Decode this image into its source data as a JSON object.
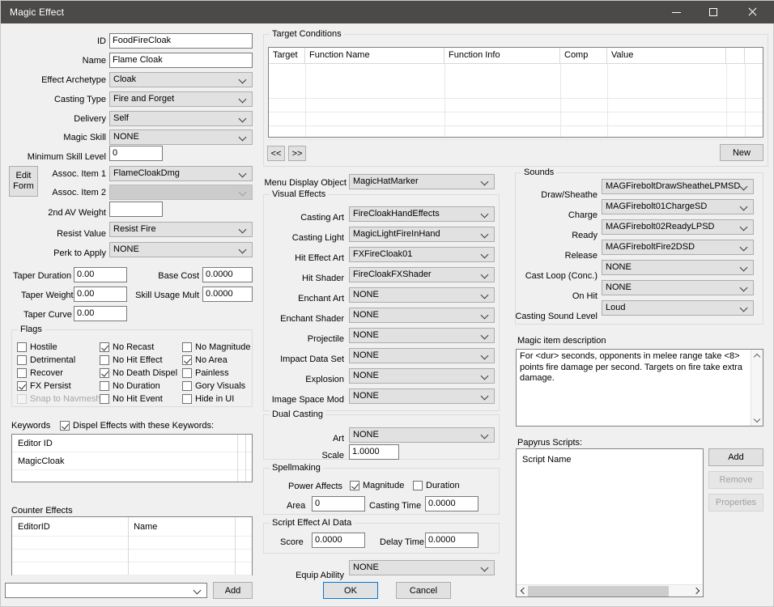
{
  "window": {
    "title": "Magic Effect",
    "titlebar_color": "#4b4a48",
    "minimize": "minimize-button",
    "maximize": "maximize-button",
    "close": "close-button"
  },
  "left": {
    "fields": [
      {
        "label": "ID",
        "value": "FoodFireCloak",
        "type": "text"
      },
      {
        "label": "Name",
        "value": "Flame Cloak",
        "type": "text"
      },
      {
        "label": "Effect Archetype",
        "value": "Cloak",
        "type": "combo"
      },
      {
        "label": "Casting Type",
        "value": "Fire and Forget",
        "type": "combo"
      },
      {
        "label": "Delivery",
        "value": "Self",
        "type": "combo"
      },
      {
        "label": "Magic Skill",
        "value": "NONE",
        "type": "combo"
      },
      {
        "label": "Minimum Skill Level",
        "value": "0",
        "type": "text"
      },
      {
        "label": "Assoc. Item 1",
        "value": "FlameCloakDmg",
        "type": "combo"
      },
      {
        "label": "Assoc. Item 2",
        "value": "",
        "type": "combo",
        "disabled": true
      },
      {
        "label": "2nd AV Weight",
        "value": "",
        "type": "text"
      },
      {
        "label": "Resist Value",
        "value": "Resist Fire",
        "type": "combo"
      },
      {
        "label": "Perk to Apply",
        "value": "NONE",
        "type": "combo"
      }
    ],
    "edit_form_button": "Edit\nForm",
    "edit_form_line1": "Edit",
    "edit_form_line2": "Form",
    "tapers": [
      {
        "label": "Taper Duration",
        "value": "0.00"
      },
      {
        "label": "Taper Weight",
        "value": "0.00"
      },
      {
        "label": "Taper Curve",
        "value": "0.00"
      }
    ],
    "costs": [
      {
        "label": "Base Cost",
        "value": "0.0000"
      },
      {
        "label": "Skill Usage Mult",
        "value": "0.0000"
      }
    ],
    "flags": {
      "caption": "Flags",
      "columns": [
        [
          {
            "label": "Hostile",
            "checked": false,
            "disabled": false
          },
          {
            "label": "Detrimental",
            "checked": false,
            "disabled": false
          },
          {
            "label": "Recover",
            "checked": false,
            "disabled": false
          },
          {
            "label": "FX Persist",
            "checked": true,
            "disabled": false
          },
          {
            "label": "Snap to Navmesh",
            "checked": false,
            "disabled": true
          }
        ],
        [
          {
            "label": "No Recast",
            "checked": true,
            "disabled": false
          },
          {
            "label": "No Hit Effect",
            "checked": false,
            "disabled": false
          },
          {
            "label": "No Death Dispel",
            "checked": true,
            "disabled": false
          },
          {
            "label": "No Duration",
            "checked": false,
            "disabled": false
          },
          {
            "label": "No Hit Event",
            "checked": false,
            "disabled": false
          }
        ],
        [
          {
            "label": "No Magnitude",
            "checked": false,
            "disabled": false
          },
          {
            "label": "No Area",
            "checked": true,
            "disabled": false
          },
          {
            "label": "Painless",
            "checked": false,
            "disabled": false
          },
          {
            "label": "Gory Visuals",
            "checked": false,
            "disabled": false
          },
          {
            "label": "Hide in UI",
            "checked": false,
            "disabled": false
          }
        ]
      ]
    },
    "keywords": {
      "label": "Keywords",
      "dispel_checkbox": "Dispel Effects with these Keywords:",
      "dispel_checked": true,
      "rows": [
        "Editor ID",
        "MagicCloak",
        "",
        ""
      ]
    },
    "counter_effects": {
      "label": "Counter Effects",
      "columns": [
        "EditorID",
        "Name"
      ],
      "rows": [
        "",
        "",
        ""
      ],
      "combo_value": "",
      "add_button": "Add"
    }
  },
  "target_conditions": {
    "caption": "Target Conditions",
    "columns": [
      "Target",
      "Function Name",
      "Function Info",
      "Comp",
      "Value",
      "",
      ""
    ],
    "rows": [],
    "prev_button": "<<",
    "next_button": ">>",
    "new_button": "New"
  },
  "center": {
    "menu_display_object": {
      "label": "Menu Display Object",
      "value": "MagicHatMarker"
    },
    "visual_effects": {
      "caption": "Visual Effects",
      "fields": [
        {
          "label": "Casting Art",
          "value": "FireCloakHandEffects"
        },
        {
          "label": "Casting Light",
          "value": "MagicLightFireInHand"
        },
        {
          "label": "Hit Effect Art",
          "value": "FXFireCloak01"
        },
        {
          "label": "Hit Shader",
          "value": "FireCloakFXShader"
        },
        {
          "label": "Enchant Art",
          "value": "NONE"
        },
        {
          "label": "Enchant Shader",
          "value": "NONE"
        },
        {
          "label": "Projectile",
          "value": "NONE"
        },
        {
          "label": "Impact Data Set",
          "value": "NONE"
        },
        {
          "label": "Explosion",
          "value": "NONE"
        },
        {
          "label": "Image Space Mod",
          "value": "NONE"
        }
      ]
    },
    "dual_casting": {
      "caption": "Dual Casting",
      "art": {
        "label": "Art",
        "value": "NONE"
      },
      "scale": {
        "label": "Scale",
        "value": "1.0000"
      }
    },
    "spellmaking": {
      "caption": "Spellmaking",
      "power_affects_label": "Power Affects",
      "magnitude": {
        "label": "Magnitude",
        "checked": true
      },
      "duration": {
        "label": "Duration",
        "checked": false
      },
      "area": {
        "label": "Area",
        "value": "0"
      },
      "casting_time": {
        "label": "Casting Time",
        "value": "0.0000"
      }
    },
    "script_effect_ai": {
      "caption": "Script Effect AI Data",
      "score": {
        "label": "Score",
        "value": "0.0000"
      },
      "delay_time": {
        "label": "Delay Time",
        "value": "0.0000"
      }
    },
    "equip_ability": {
      "label": "Equip Ability",
      "value": "NONE"
    },
    "ok_button": "OK",
    "cancel_button": "Cancel"
  },
  "right": {
    "sounds": {
      "caption": "Sounds",
      "fields": [
        {
          "label": "Draw/Sheathe",
          "value": "MAGFireboltDrawSheatheLPMSD"
        },
        {
          "label": "Charge",
          "value": "MAGFirebolt01ChargeSD"
        },
        {
          "label": "Ready",
          "value": "MAGFirebolt02ReadyLPSD"
        },
        {
          "label": "Release",
          "value": "MAGFireboltFire2DSD"
        },
        {
          "label": "Cast Loop (Conc.)",
          "value": "NONE"
        },
        {
          "label": "On Hit",
          "value": "NONE"
        },
        {
          "label": "Casting Sound Level",
          "value": "Loud"
        }
      ]
    },
    "magic_item_description": {
      "label": "Magic item description",
      "text": "For <dur> seconds, opponents in melee range take <8> points fire damage per second. Targets on fire take extra damage."
    },
    "papyrus_scripts": {
      "label": "Papyrus Scripts:",
      "header": "Script Name",
      "rows": [],
      "add_button": "Add",
      "remove_button": "Remove",
      "properties_button": "Properties"
    }
  }
}
